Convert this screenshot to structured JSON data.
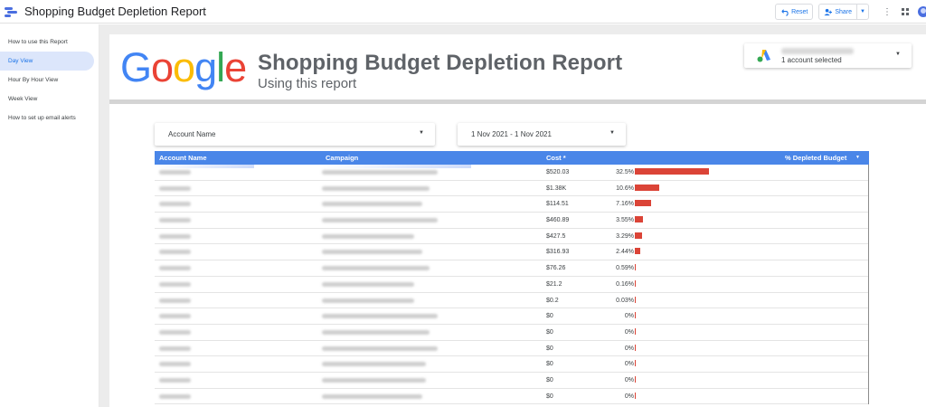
{
  "app": {
    "title": "Shopping Budget Depletion Report",
    "reset_label": "Reset",
    "share_label": "Share"
  },
  "sidebar": {
    "items": [
      {
        "label": "How to use this Report",
        "active": false
      },
      {
        "label": "Day View",
        "active": true
      },
      {
        "label": "Hour By Hour View",
        "active": false
      },
      {
        "label": "Week View",
        "active": false
      },
      {
        "label": "How to set up email alerts",
        "active": false
      }
    ]
  },
  "report": {
    "logo_text": "Google",
    "title": "Shopping Budget Depletion Report",
    "subtitle": "Using this report",
    "account_selector": "1 account selected"
  },
  "filters": {
    "account_name": "Account Name",
    "date_range": "1 Nov 2021 - 1 Nov 2021"
  },
  "table": {
    "headers": {
      "account": "Account Name",
      "campaign": "Campaign",
      "cost": "Cost *",
      "depleted": "% Depleted Budget"
    },
    "rows": [
      {
        "cost": "$520.03",
        "pct": "32.5%",
        "value": 32.5
      },
      {
        "cost": "$1.38K",
        "pct": "10.6%",
        "value": 10.6
      },
      {
        "cost": "$114.51",
        "pct": "7.16%",
        "value": 7.16
      },
      {
        "cost": "$460.89",
        "pct": "3.55%",
        "value": 3.55
      },
      {
        "cost": "$427.5",
        "pct": "3.29%",
        "value": 3.29
      },
      {
        "cost": "$316.93",
        "pct": "2.44%",
        "value": 2.44
      },
      {
        "cost": "$76.26",
        "pct": "0.59%",
        "value": 0.59
      },
      {
        "cost": "$21.2",
        "pct": "0.16%",
        "value": 0.16
      },
      {
        "cost": "$0.2",
        "pct": "0.03%",
        "value": 0.03
      },
      {
        "cost": "$0",
        "pct": "0%",
        "value": 0
      },
      {
        "cost": "$0",
        "pct": "0%",
        "value": 0
      },
      {
        "cost": "$0",
        "pct": "0%",
        "value": 0
      },
      {
        "cost": "$0",
        "pct": "0%",
        "value": 0
      },
      {
        "cost": "$0",
        "pct": "0%",
        "value": 0
      },
      {
        "cost": "$0",
        "pct": "0%",
        "value": 0
      }
    ]
  },
  "colors": {
    "header_blue": "#4a86e8",
    "bar_red": "#db4437",
    "nav_active_bg": "#dce6fb",
    "accent": "#1a73e8"
  },
  "icons": [
    "datastudio-logo-icon",
    "reset-icon",
    "share-person-icon",
    "more-vert-icon",
    "apps-grid-icon",
    "avatar-icon",
    "google-ads-icon",
    "dropdown-caret-icon",
    "sort-desc-icon"
  ]
}
